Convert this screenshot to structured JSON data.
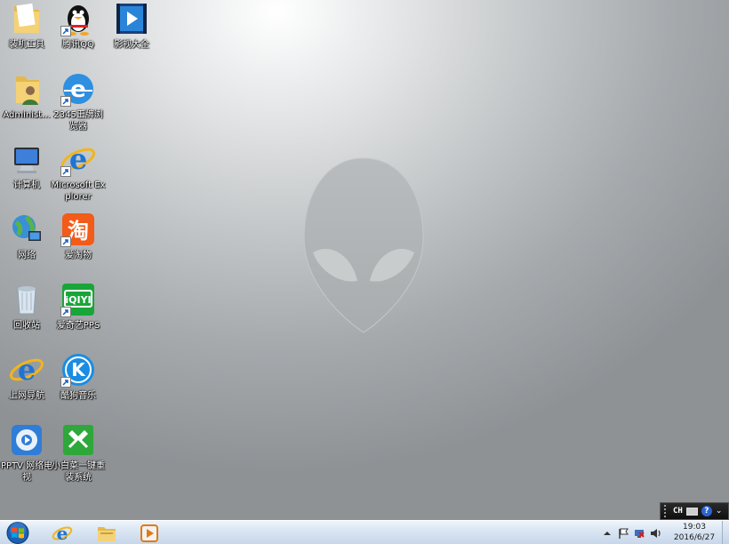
{
  "desktop": {
    "wallpaper": "Alienware gray",
    "icons": [
      {
        "label": "装机工具",
        "icon": "folder-icon"
      },
      {
        "label": "腾讯QQ",
        "icon": "qq-penguin-icon"
      },
      {
        "label": "影视大全",
        "icon": "video-player-icon"
      },
      {
        "label": "Administ...",
        "icon": "user-folder-icon"
      },
      {
        "label": "2345王牌浏览器",
        "icon": "browser-2345-icon"
      },
      {
        "label": "计算机",
        "icon": "computer-icon"
      },
      {
        "label": "Microsoft Explorer",
        "icon": "internet-explorer-icon"
      },
      {
        "label": "网络",
        "icon": "network-icon"
      },
      {
        "label": "爱淘物",
        "icon": "taobao-icon"
      },
      {
        "label": "回收站",
        "icon": "recycle-bin-icon"
      },
      {
        "label": "爱奇艺PPS",
        "icon": "iqiyi-icon"
      },
      {
        "label": "上网导航",
        "icon": "ie-navigation-icon"
      },
      {
        "label": "酷狗音乐",
        "icon": "kugou-music-icon"
      },
      {
        "label": "PPTV 网络电视",
        "icon": "pptv-icon"
      },
      {
        "label": "小白菜一键重装系统",
        "icon": "reinstall-system-icon"
      }
    ]
  },
  "langbar": {
    "language": "CH",
    "help": "?"
  },
  "taskbar": {
    "start": "start-orb-icon",
    "pinned": [
      "internet-explorer-icon",
      "file-explorer-icon",
      "media-player-icon"
    ],
    "tray": [
      "arrow-up-icon",
      "action-center-flag-icon",
      "network-error-icon",
      "volume-icon"
    ],
    "clock": {
      "time": "19:03",
      "date": "2016/6/27"
    }
  },
  "colors": {
    "taskbar": "#d9e5f2",
    "wallpaper_center": "#e4e6e7",
    "wallpaper_edge": "#8e9295"
  }
}
